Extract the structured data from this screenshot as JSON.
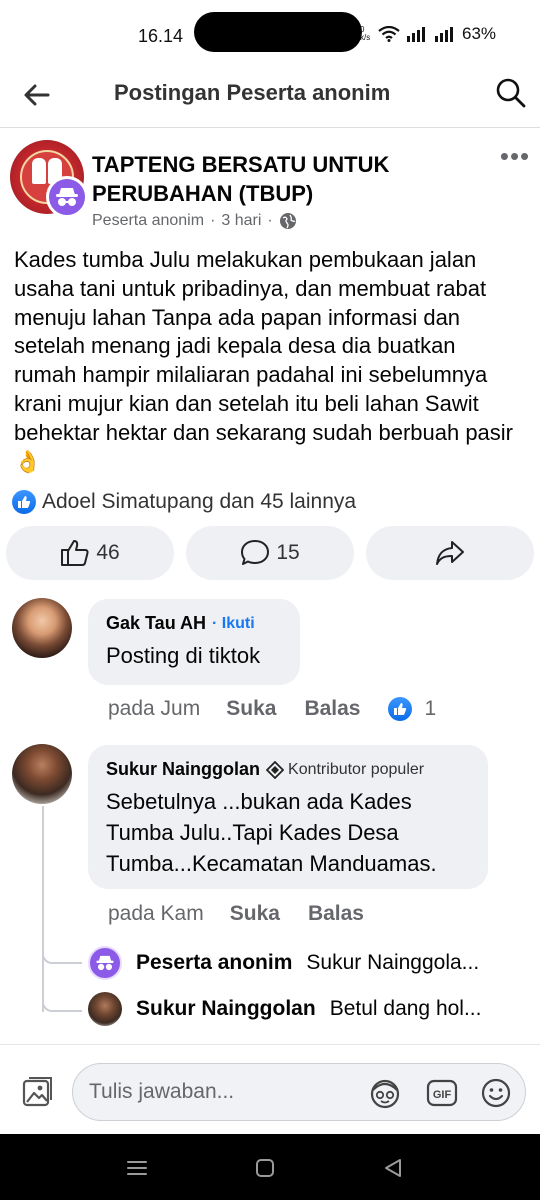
{
  "status_bar": {
    "time": "16.14",
    "network_small": "0\nk/s",
    "battery": "63%"
  },
  "header": {
    "title": "Postingan Peserta anonim",
    "back_icon": "arrow-left-icon",
    "search_icon": "search-icon"
  },
  "post": {
    "group_name": "TAPTENG BERSATU UNTUK PERUBAHAN (TBUP)",
    "author": "Peserta anonim",
    "separator": "·",
    "time": "3 hari",
    "privacy_icon": "globe-icon",
    "body": "Kades tumba Julu melakukan pembukaan jalan usaha tani untuk pribadinya, dan membuat rabat menuju lahan Tanpa ada papan informasi dan setelah menang jadi kepala desa dia buatkan rumah hampir milaliaran padahal ini sebelumnya krani mujur kian dan setelah itu beli lahan Sawit behektar hektar dan sekarang sudah berbuah pasir👌",
    "reactions_text": "Adoel Simatupang dan 45 lainnya",
    "like_count": "46",
    "comment_count": "15"
  },
  "comments": [
    {
      "author": "Gak Tau AH",
      "follow_label": "· Ikuti",
      "text": "Posting di tiktok",
      "time": "pada Jum",
      "like_label": "Suka",
      "reply_label": "Balas",
      "reaction_count": "1"
    },
    {
      "author": "Sukur Nainggolan",
      "badge": "Kontributor populer",
      "text": "Sebetulnya ...bukan ada Kades Tumba Julu..Tapi Kades Desa Tumba...Kecamatan Manduamas.",
      "time": "pada Kam",
      "like_label": "Suka",
      "reply_label": "Balas"
    }
  ],
  "replies": [
    {
      "author": "Peserta anonim",
      "preview": "Sukur Nainggola..."
    },
    {
      "author": "Sukur Nainggolan",
      "preview": "Betul dang hol..."
    }
  ],
  "composer": {
    "placeholder": "Tulis jawaban...",
    "gif_label": "GIF"
  },
  "colors": {
    "accent": "#1877f2",
    "bubble": "#eef0f3",
    "anon_purple": "#8b5ae6",
    "secondary_text": "#65676b"
  }
}
